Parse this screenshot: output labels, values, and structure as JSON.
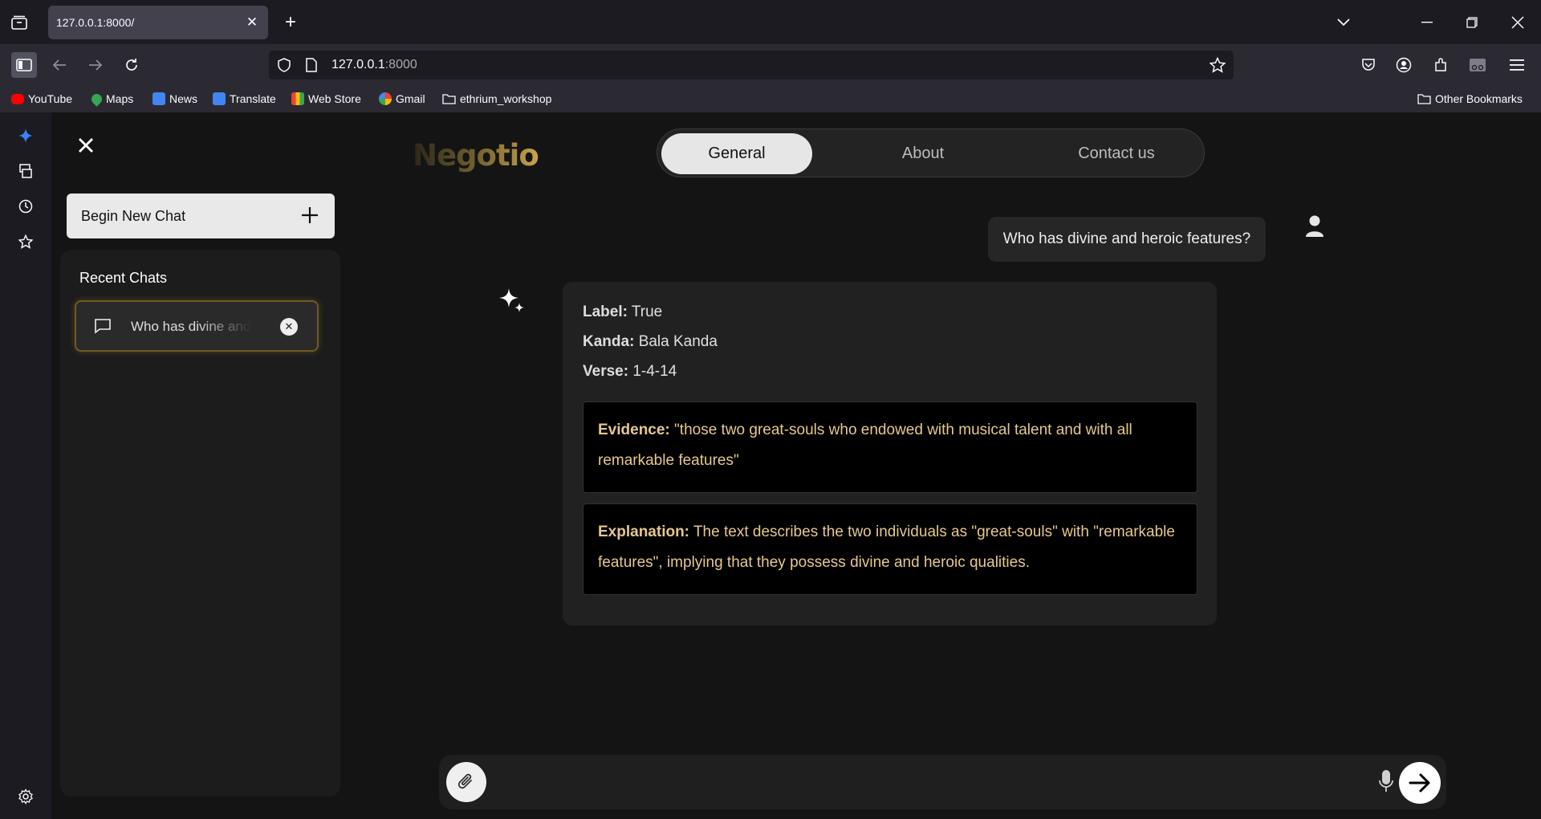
{
  "browser": {
    "tab_title": "127.0.0.1:8000/",
    "url_host": "127.0.0.1",
    "url_port": ":8000",
    "bookmarks": [
      {
        "label": "YouTube",
        "color": "#ff0000"
      },
      {
        "label": "Maps",
        "color": "#34a853"
      },
      {
        "label": "News",
        "color": "#4285f4"
      },
      {
        "label": "Translate",
        "color": "#4285f4"
      },
      {
        "label": "Web Store",
        "color": "#ea4335"
      },
      {
        "label": "Gmail",
        "color": "#ffffff"
      },
      {
        "label": "ethrium_workshop",
        "color": ""
      }
    ],
    "other_bookmarks": "Other Bookmarks"
  },
  "app": {
    "logo": "Negotio",
    "new_chat_label": "Begin New Chat",
    "recent_title": "Recent Chats",
    "recent_chats": [
      {
        "label": "Who has divine and heroic features?"
      }
    ],
    "nav_tabs": [
      {
        "label": "General",
        "active": true
      },
      {
        "label": "About",
        "active": false
      },
      {
        "label": "Contact us",
        "active": false
      }
    ],
    "user_message": "Who has divine and heroic features?",
    "answer": {
      "label_key": "Label:",
      "label_value": "True",
      "kanda_key": "Kanda:",
      "kanda_value": "Bala Kanda",
      "verse_key": "Verse:",
      "verse_value": "1-4-14",
      "evidence_key": "Evidence:",
      "evidence_value": "\"those two great-souls who endowed with musical talent and with all remarkable features\"",
      "explanation_key": "Explanation:",
      "explanation_value": "The text describes the two individuals as \"great-souls\" with \"remarkable features\", implying that they possess divine and heroic qualities."
    },
    "input_placeholder": "",
    "accent_color": "#e6c78e"
  }
}
